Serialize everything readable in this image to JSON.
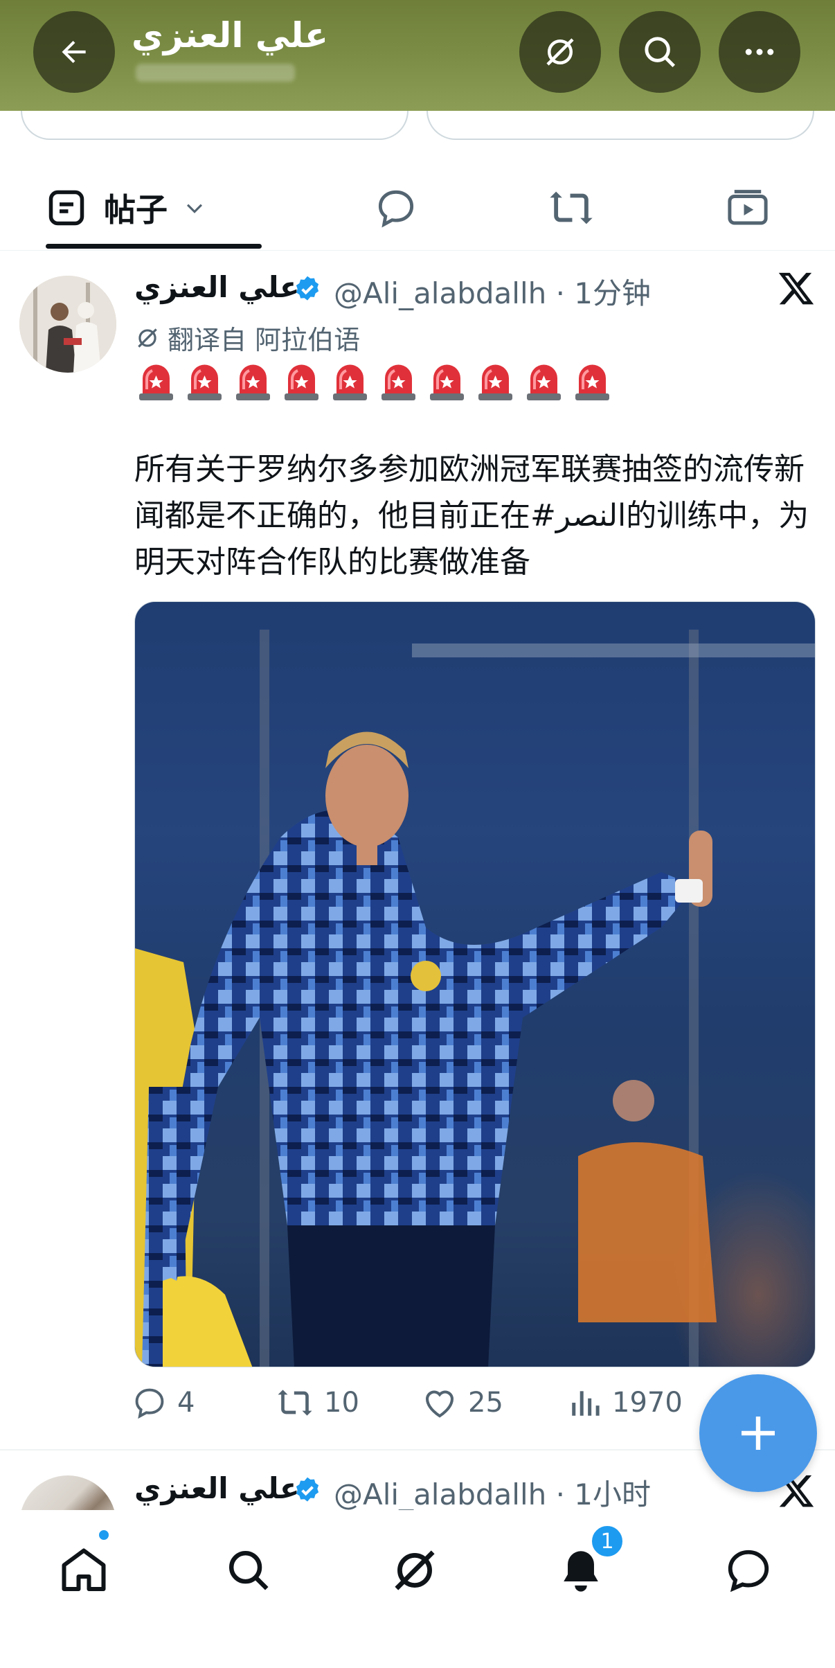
{
  "header": {
    "title": "علي العنزي",
    "back_icon": "arrow-left-icon",
    "grok_icon": "grok-icon",
    "search_icon": "search-icon",
    "more_icon": "more-icon"
  },
  "tabs": [
    {
      "label": "帖子",
      "icon": "post-icon",
      "selected": true
    },
    {
      "label": "",
      "icon": "reply-icon",
      "selected": false
    },
    {
      "label": "",
      "icon": "repost-icon",
      "selected": false
    },
    {
      "label": "",
      "icon": "media-icon",
      "selected": false
    }
  ],
  "post": {
    "author_name": "علي العنزي",
    "handle": "@Ali_alabdallh",
    "time": "1分钟",
    "translated_label": "翻译自 阿拉伯语",
    "siren_count": 10,
    "text": "所有关于罗纳尔多参加欧洲冠军联赛抽签的流传新闻都是不正确的，他目前正在#النصر的训练中，为明天对阵合作队的比赛做准备",
    "actions": {
      "replies": "4",
      "reposts": "10",
      "likes": "25",
      "views": "1970"
    }
  },
  "post2": {
    "author_name": "علي العنزي",
    "handle": "@Ali_alabdallh",
    "time": "1小时"
  },
  "bottom_nav": {
    "notifications_badge": "1"
  },
  "colors": {
    "accent": "#1d9bf0",
    "fab": "#4a99e9",
    "secondary_text": "#536471"
  }
}
